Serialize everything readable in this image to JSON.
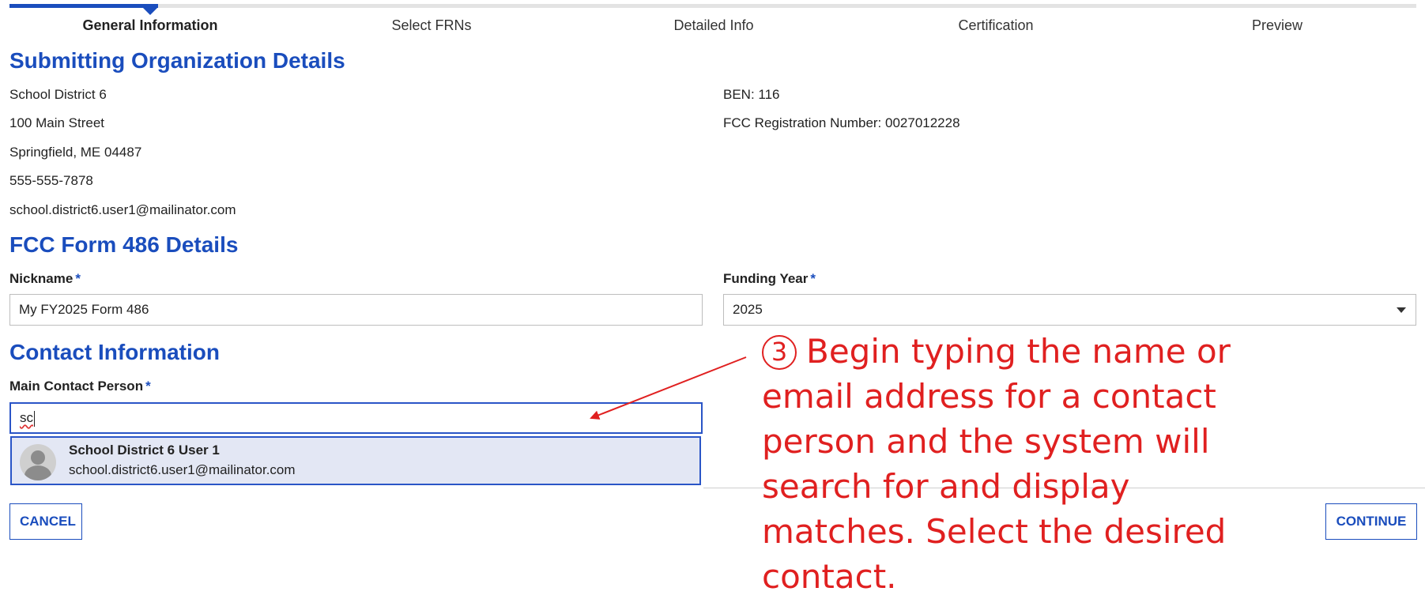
{
  "steps": [
    {
      "label": "General Information",
      "active": true
    },
    {
      "label": "Select FRNs",
      "active": false
    },
    {
      "label": "Detailed Info",
      "active": false
    },
    {
      "label": "Certification",
      "active": false
    },
    {
      "label": "Preview",
      "active": false
    }
  ],
  "org": {
    "heading": "Submitting Organization Details",
    "name": "School District 6",
    "street": "100 Main Street",
    "city": "Springfield, ME 04487",
    "phone": "555-555-7878",
    "email": "school.district6.user1@mailinator.com",
    "ben": "BEN: 116",
    "fcc_reg": "FCC Registration Number: 0027012228"
  },
  "form": {
    "heading": "FCC Form 486 Details",
    "nickname_label": "Nickname",
    "nickname_value": "My FY2025 Form 486",
    "funding_year_label": "Funding Year",
    "funding_year_value": "2025",
    "required_mark": "*"
  },
  "contact": {
    "heading": "Contact Information",
    "main_contact_label": "Main Contact Person",
    "typed_value": "sc",
    "suggestion": {
      "name": "School District 6 User 1",
      "email": "school.district6.user1@mailinator.com"
    }
  },
  "buttons": {
    "cancel": "CANCEL",
    "continue": "CONTINUE"
  },
  "annotation": {
    "step_number": "3",
    "text": "Begin typing the name or email address for a contact person and the system will search for and display matches. Select the desired contact.",
    "color": "#e02020"
  },
  "colors": {
    "accent": "#1a4dbd",
    "heading": "#1a4dbd"
  }
}
